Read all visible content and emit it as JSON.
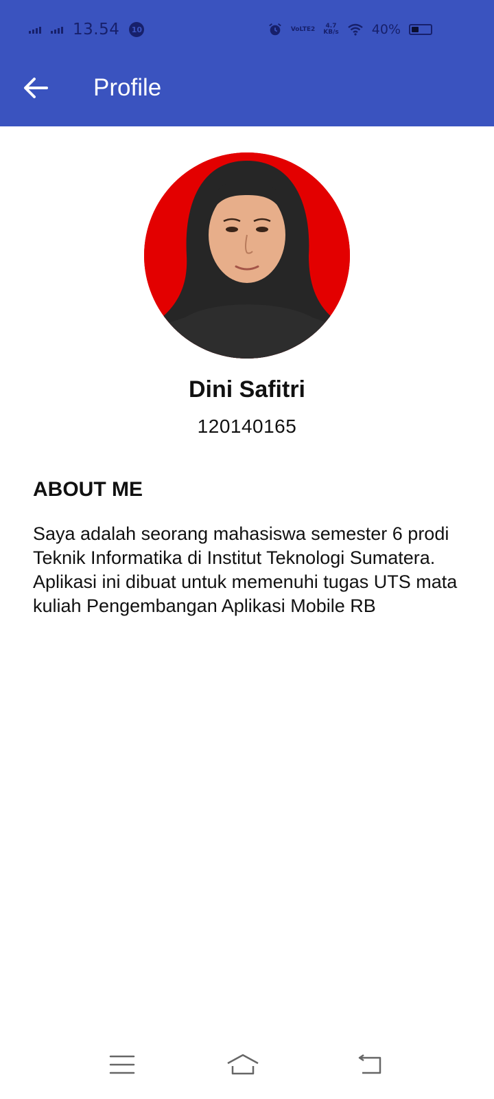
{
  "status_bar": {
    "time": "13.54",
    "notification_badge": "10",
    "volte": "VoLTE2",
    "speed_value": "4.7",
    "speed_unit": "KB/s",
    "battery_percent": "40%",
    "battery_level": 0.4,
    "icons": [
      "signal-icon",
      "alarm-icon",
      "wifi-icon",
      "battery-icon"
    ]
  },
  "app_bar": {
    "title": "Profile",
    "back_icon": "arrow-left-icon",
    "color": "#3a53bf"
  },
  "profile": {
    "name": "Dini Safitri",
    "id_number": "120140165",
    "photo_background": "#e30000"
  },
  "about": {
    "heading": "ABOUT ME",
    "text": "Saya adalah seorang mahasiswa semester 6 prodi Teknik Informatika di Institut Teknologi Sumatera. Aplikasi ini dibuat untuk memenuhi tugas UTS mata kuliah Pengembangan Aplikasi Mobile RB"
  },
  "nav_bar": {
    "icons": [
      "menu-icon",
      "home-icon",
      "back-nav-icon"
    ]
  }
}
